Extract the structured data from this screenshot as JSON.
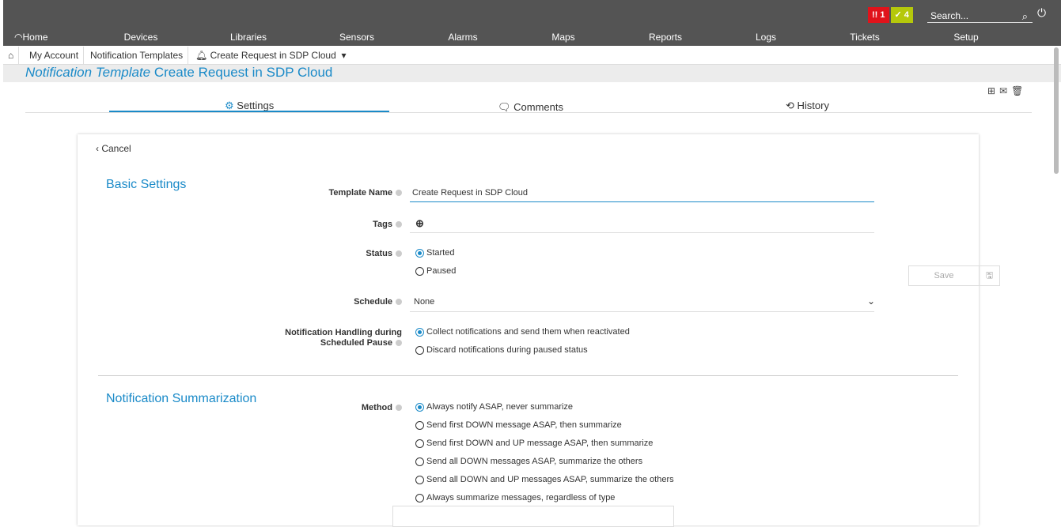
{
  "alerts": {
    "red_count": "!! 1",
    "green_count": "✓ 4"
  },
  "search": {
    "placeholder": "Search..."
  },
  "nav": [
    "Home",
    "Devices",
    "Libraries",
    "Sensors",
    "Alarms",
    "Maps",
    "Reports",
    "Logs",
    "Tickets",
    "Setup"
  ],
  "breadcrumbs": {
    "item1": "My Account",
    "item2": "Notification Templates",
    "item3": "Create Request in SDP Cloud"
  },
  "page_title": {
    "prefix": "Notification Template",
    "name": "Create Request in SDP Cloud"
  },
  "tabs": {
    "settings": "Settings",
    "comments": "Comments",
    "history": "History"
  },
  "cancel_label": "Cancel",
  "basic": {
    "section_title": "Basic Settings",
    "template_name_label": "Template Name",
    "template_name_value": "Create Request in SDP Cloud",
    "tags_label": "Tags",
    "status_label": "Status",
    "status_started": "Started",
    "status_paused": "Paused",
    "schedule_label": "Schedule",
    "schedule_value": "None",
    "handling_label_1": "Notification Handling during",
    "handling_label_2": "Scheduled Pause",
    "handling_collect": "Collect notifications and send them when reactivated",
    "handling_discard": "Discard notifications during paused status"
  },
  "summ": {
    "section_title": "Notification Summarization",
    "method_label": "Method",
    "options": [
      "Always notify ASAP, never summarize",
      "Send first DOWN message ASAP, then summarize",
      "Send first DOWN and UP message ASAP, then summarize",
      "Send all DOWN messages ASAP, summarize the others",
      "Send all DOWN and UP messages ASAP, summarize the others",
      "Always summarize messages, regardless of type"
    ]
  },
  "save_label": "Save"
}
